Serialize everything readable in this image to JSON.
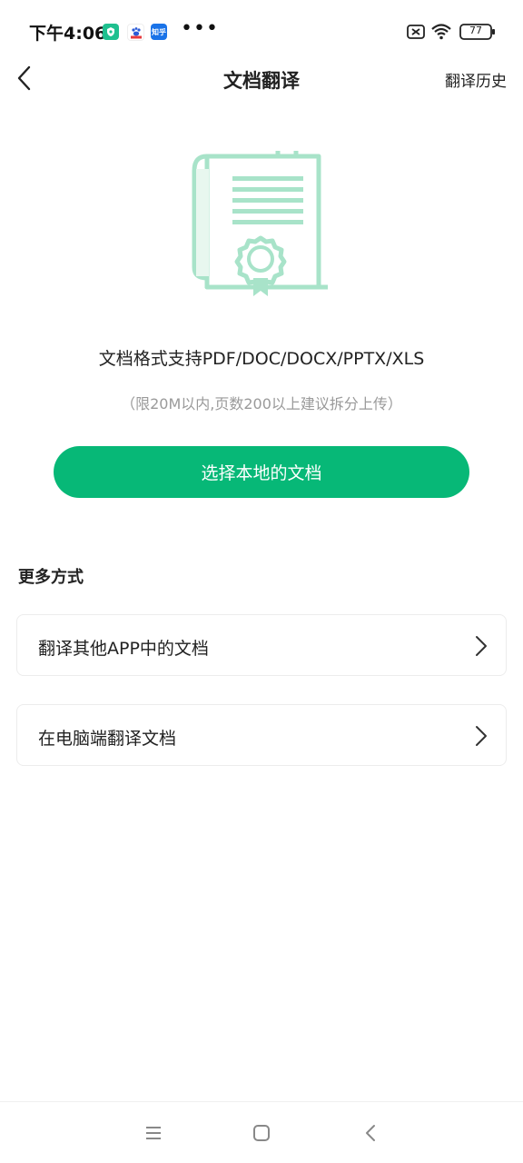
{
  "status_bar": {
    "time": "下午4:06",
    "notif_icons": [
      {
        "name": "app-shield-icon",
        "color": "#1fc08f",
        "glyph": "◆"
      },
      {
        "name": "baidu-icon",
        "color": "#e6393e",
        "glyph": "百"
      },
      {
        "name": "zhihu-icon",
        "color": "#1a73e8",
        "glyph": "知乎"
      }
    ],
    "more": "•••",
    "battery": "77"
  },
  "header": {
    "title": "文档翻译",
    "history": "翻译历史"
  },
  "hero": {
    "formats": "文档格式支持PDF/DOC/DOCX/PPTX/XLS",
    "limit": "（限20M以内,页数200以上建议拆分上传）",
    "select_button": "选择本地的文档",
    "accent_color": "#07b877",
    "illustration_color": "#a8e3c9"
  },
  "more": {
    "title": "更多方式",
    "options": [
      {
        "label": "翻译其他APP中的文档"
      },
      {
        "label": "在电脑端翻译文档"
      }
    ]
  }
}
